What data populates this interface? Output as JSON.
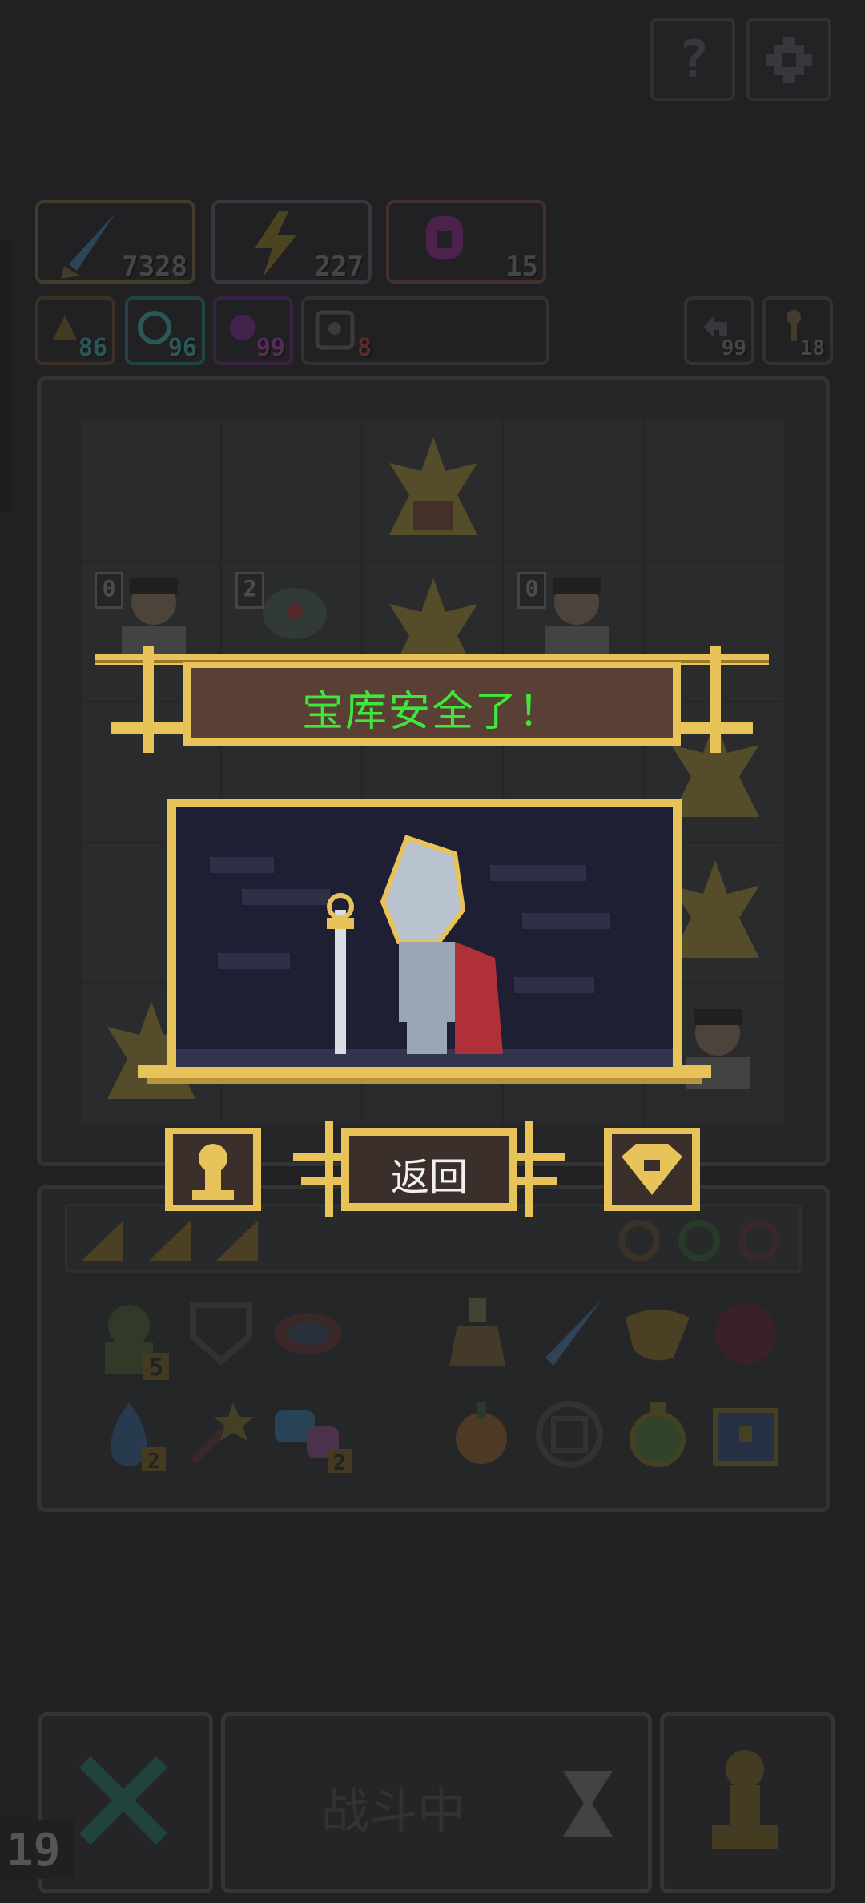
{
  "top_buttons": {
    "help_icon": "question-icon",
    "settings_icon": "gear-icon"
  },
  "stats": {
    "attack": {
      "icon": "sword-icon",
      "value": "7328",
      "color": "#7a6a48"
    },
    "energy": {
      "icon": "lightning-icon",
      "value": "227",
      "color": "#7a6a48"
    },
    "mana": {
      "icon": "potion-icon",
      "value": "15",
      "color": "#8a5a4a"
    }
  },
  "sub_stats": [
    {
      "icon": "flame-icon",
      "value": "86",
      "color": "#3f8f8f"
    },
    {
      "icon": "swirl-icon",
      "value": "96",
      "color": "#3f8f8f"
    },
    {
      "icon": "magic-icon",
      "value": "99",
      "color": "#8a3f8f"
    },
    {
      "icon": "skull-icon",
      "value": "8",
      "color": "#9a3f3f"
    }
  ],
  "counters": {
    "undo": "99",
    "keys": "18"
  },
  "board": {
    "rows": [
      [
        "",
        "",
        "dragon",
        "",
        ""
      ],
      [
        "scholar:0",
        "spider:2",
        "dragon",
        "scholar:0",
        ""
      ],
      [
        "",
        "dragon",
        "dragon",
        "scholar",
        "dragon"
      ],
      [
        "",
        "",
        "",
        "",
        "dragon"
      ],
      [
        "dragon",
        "",
        "",
        "",
        "scholar"
      ]
    ]
  },
  "dialog": {
    "title": "宝库安全了！",
    "back_button": "返回",
    "hero": "knight"
  },
  "inventory": {
    "items": [
      {
        "icon": "goblin-icon",
        "count": "5"
      },
      {
        "icon": "shield-icon",
        "count": ""
      },
      {
        "icon": "helmet-icon",
        "count": ""
      },
      {
        "icon": "flask-icon",
        "count": ""
      },
      {
        "icon": "dagger-icon",
        "count": ""
      },
      {
        "icon": "horn-icon",
        "count": ""
      },
      {
        "icon": "orb-icon",
        "count": ""
      },
      {
        "icon": "droplet-icon",
        "count": "2"
      },
      {
        "icon": "wand-icon",
        "count": ""
      },
      {
        "icon": "axe-icon",
        "count": "2"
      },
      {
        "icon": "fruit-icon",
        "count": ""
      },
      {
        "icon": "rune-icon",
        "count": ""
      },
      {
        "icon": "potion-icon",
        "count": ""
      },
      {
        "icon": "chest-icon",
        "count": ""
      }
    ]
  },
  "bottom": {
    "status": "战斗中",
    "turn": "19"
  }
}
